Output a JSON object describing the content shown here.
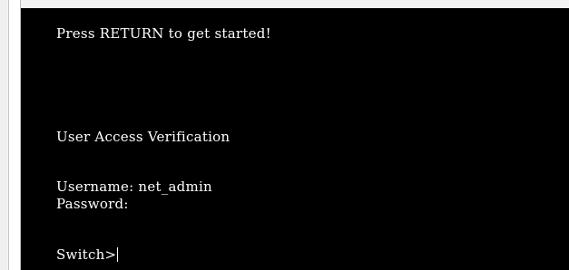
{
  "terminal": {
    "lines": {
      "banner": "Press RETURN to get started!",
      "verification_title": "User Access Verification",
      "username_line": "Username: net_admin",
      "password_line": "Password:",
      "prompt": "Switch>"
    }
  },
  "colors": {
    "terminal_background": "#000000",
    "terminal_text": "#ffffff",
    "window_background": "#f4f4f4"
  }
}
